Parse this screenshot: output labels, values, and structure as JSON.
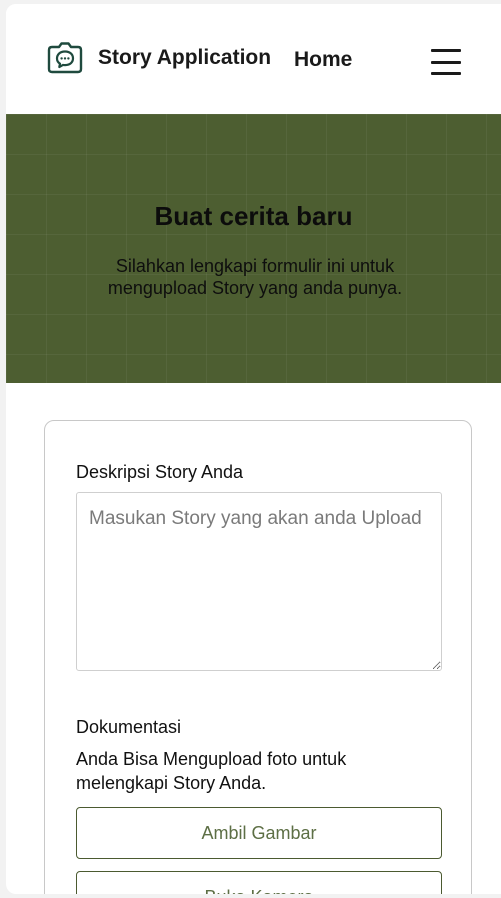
{
  "header": {
    "app_title": "Story Application",
    "nav_home": "Home"
  },
  "hero": {
    "title": "Buat cerita baru",
    "subtitle": "Silahkan lengkapi formulir ini untuk mengupload Story yang anda punya."
  },
  "form": {
    "description_label": "Deskripsi Story Anda",
    "description_placeholder": "Masukan Story yang akan anda Upload",
    "documentation_label": "Dokumentasi",
    "documentation_help": "Anda Bisa Mengupload foto untuk melengkapi Story Anda.",
    "take_photo_button": "Ambil Gambar",
    "open_camera_button": "Buka Kamera"
  },
  "colors": {
    "hero_bg": "#4d5e31",
    "accent": "#4b5a30",
    "button_text": "#5d6f45"
  },
  "icons": {
    "brand": "camera-chat-icon",
    "menu": "hamburger-menu-icon"
  }
}
